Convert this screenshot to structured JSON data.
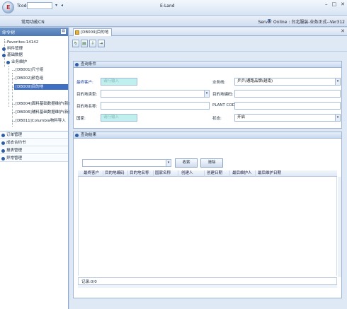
{
  "titlebar": {
    "tcode_label": "Tcode",
    "tcode_value": "",
    "title": "E-Land",
    "min": "–",
    "max": "□",
    "close": "✕"
  },
  "bar2": {
    "favorites_func": "常用功能CN",
    "server_status": "Server Online : 台北服装-业务正式--Ver312"
  },
  "sidebar": {
    "header": "命令树",
    "tree": [
      {
        "label": "Favorites:14142"
      },
      {
        "label": "料件管理"
      },
      {
        "label": "基础数据"
      },
      {
        "label": "业务维护"
      },
      {
        "label": "[DB001]尺寸组"
      },
      {
        "label": "[DB002]颜色组"
      },
      {
        "label": "[DB009]目的地"
      },
      {
        "label": "[DB004]面料基础数据维护(新)"
      },
      {
        "label": "[DB006]辅料基础数据维护(新)"
      },
      {
        "label": "[DB011]Columbia物料导入"
      }
    ],
    "sections": [
      "订单管理",
      "成衣合约书",
      "报表管理",
      "异常管理"
    ]
  },
  "tab": {
    "label": "[DB009]目的地"
  },
  "conditions": {
    "header": "查询条件",
    "customer_label": "最终客户:",
    "customer_placeholder": "请行输入",
    "dest_type_label": "目的地类型:",
    "dest_name_label": "目的地名称:",
    "country_label": "国家:",
    "country_placeholder": "请行输入",
    "business_label": "业务线:",
    "business_value": "乒乒/通路品牌(越南)",
    "dest_code_label": "目的地编码:",
    "plant_code_label": "PLANT CODE:",
    "status_label": "状态:",
    "status_value": "开启"
  },
  "results": {
    "header": "查询结果",
    "query_button": "收索",
    "clear_button": "清除",
    "columns": [
      "最终客户",
      "目的地编码",
      "目的地名称",
      "国家名称",
      "创建人",
      "创建日期",
      "最后维护人",
      "最后维护日期"
    ],
    "record_count": "记录:0/0"
  }
}
